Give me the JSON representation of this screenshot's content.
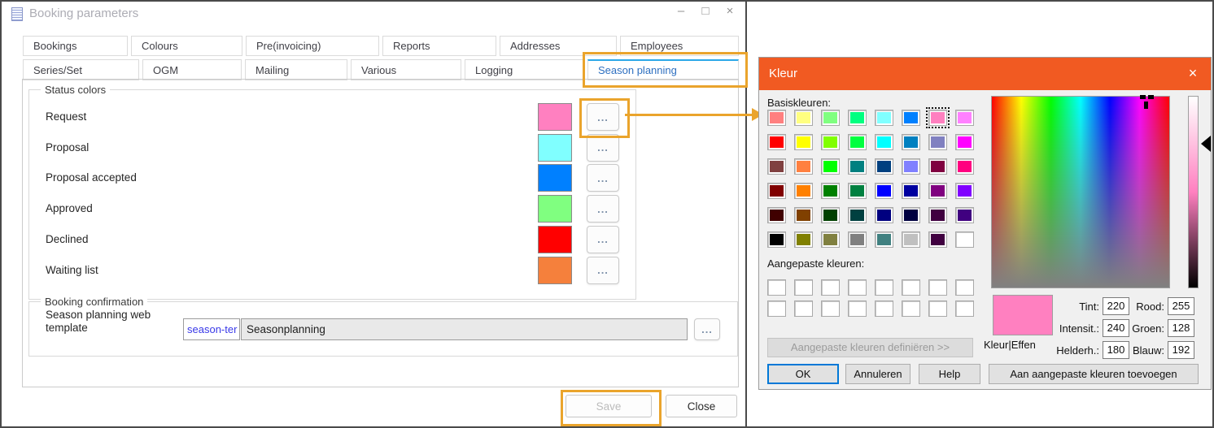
{
  "ui_colors": {
    "hl": "#EAA42C",
    "kd-orange": "#F15A22",
    "tab-accent": "#2BA8E8",
    "tab-text": "#2D6FC0",
    "focus": "#0078D7"
  },
  "booking_window": {
    "title": "Booking parameters",
    "controls": {
      "minimize": "–",
      "maximize": "□",
      "close": "×"
    },
    "tabs_row1": [
      "Bookings",
      "Colours",
      "Pre(invoicing)",
      "Reports",
      "Addresses",
      "Employees"
    ],
    "tabs_row2": [
      "Series/Set",
      "OGM",
      "Mailing",
      "Various",
      "Logging",
      "Season planning"
    ],
    "selected_tab": "Season planning",
    "status_group": {
      "label": "Status colors",
      "ellipsis_label": "...",
      "rows": [
        {
          "label": "Request",
          "color": "#FF80C0"
        },
        {
          "label": "Proposal",
          "color": "#80FFFF"
        },
        {
          "label": "Proposal accepted",
          "color": "#0080FF"
        },
        {
          "label": "Approved",
          "color": "#80FF80"
        },
        {
          "label": "Declined",
          "color": "#FF0000"
        },
        {
          "label": "Waiting list",
          "color": "#F5803C"
        }
      ]
    },
    "confirmation_group": {
      "label": "Booking confirmation",
      "field_label": "Season planning web template",
      "code_value": "season-ter",
      "template_value": "Seasonplanning",
      "ellipsis_label": "..."
    },
    "save_button": "Save",
    "close_button": "Close"
  },
  "kleur_dialog": {
    "title": "Kleur",
    "close_icon": "×",
    "basic_colors_label": "Basiskleuren:",
    "basic_colors": [
      "#FF8080",
      "#FFFF80",
      "#80FF80",
      "#00FF80",
      "#80FFFF",
      "#0080FF",
      "#FF80C0",
      "#FF80FF",
      "#FF0000",
      "#FFFF00",
      "#80FF00",
      "#00FF40",
      "#00FFFF",
      "#0080C0",
      "#8080C0",
      "#FF00FF",
      "#804040",
      "#FF8040",
      "#00FF00",
      "#008080",
      "#004080",
      "#8080FF",
      "#800040",
      "#FF0080",
      "#800000",
      "#FF8000",
      "#008000",
      "#008040",
      "#0000FF",
      "#0000A0",
      "#800080",
      "#8000FF",
      "#400000",
      "#804000",
      "#004000",
      "#004040",
      "#000080",
      "#000040",
      "#400040",
      "#400080",
      "#000000",
      "#808000",
      "#808040",
      "#808080",
      "#408080",
      "#C0C0C0",
      "#400040",
      "#FFFFFF"
    ],
    "selected_basic_index": 6,
    "custom_colors_label": "Aangepaste kleuren:",
    "custom_colors_count": 16,
    "custom_color": "#FFFFFF",
    "define_custom_button": "Aangepaste kleuren definiëren >>",
    "ok_button": "OK",
    "cancel_button": "Annuleren",
    "help_button": "Help",
    "preview_color": "#FF80C0",
    "preview_label": "Kleur|Effen",
    "hsl_fields": [
      {
        "label": "Tint:",
        "value": "220"
      },
      {
        "label": "Intensit.:",
        "value": "240"
      },
      {
        "label": "Helderh.:",
        "value": "180"
      }
    ],
    "rgb_fields": [
      {
        "label": "Rood:",
        "value": "255"
      },
      {
        "label": "Groen:",
        "value": "128"
      },
      {
        "label": "Blauw:",
        "value": "192"
      }
    ],
    "add_custom_button": "Aan aangepaste kleuren toevoegen"
  }
}
